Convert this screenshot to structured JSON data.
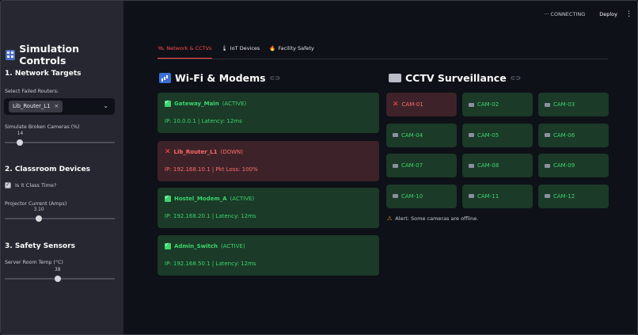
{
  "topbar": {
    "status_label": "CONNECTING",
    "deploy_label": "Deploy"
  },
  "sidebar": {
    "title": "Simulation Controls",
    "section1": "1. Network Targets",
    "failed_routers_label": "Select Failed Routers:",
    "failed_routers_selected": [
      "Lib_Router_L1"
    ],
    "broken_cameras_label": "Simulate Broken Cameras (%)",
    "broken_cameras_value": 14,
    "broken_cameras_fraction": 0.14,
    "section2": "2. Classroom Devices",
    "class_time_label": "Is it Class Time?",
    "class_time_checked": true,
    "projector_label": "Projector Current (Amps)",
    "projector_value": "3.10",
    "projector_fraction": 0.31,
    "section3": "3. Safety Sensors",
    "temp_label": "Server Room Temp (°C)",
    "temp_value": 38,
    "temp_fraction": 0.48
  },
  "tabs": [
    {
      "label": "Network & CCTVs",
      "icon": "satellite-icon",
      "active": true
    },
    {
      "label": "IoT Devices",
      "icon": "thermometer-icon",
      "active": false
    },
    {
      "label": "Facility Safety",
      "icon": "fire-icon",
      "active": false
    }
  ],
  "wifi": {
    "title": "Wi-Fi & Modems",
    "routers": [
      {
        "name": "Gateway_Main",
        "status": "(ACTIVE)",
        "detail": "IP: 10.0.0.1 | Latency: 12ms",
        "ok": true
      },
      {
        "name": "Lib_Router_L1",
        "status": "(DOWN)",
        "detail": "IP: 192.168.10.1 | Pkt Loss: 100%",
        "ok": false
      },
      {
        "name": "Hostel_Modem_A",
        "status": "(ACTIVE)",
        "detail": "IP: 192.168.20.1 | Latency: 12ms",
        "ok": true
      },
      {
        "name": "Admin_Switch",
        "status": "(ACTIVE)",
        "detail": "IP: 192.168.50.1 | Latency: 12ms",
        "ok": true
      }
    ]
  },
  "cctv": {
    "title": "CCTV Surveillance",
    "cameras": [
      {
        "label": "CAM-01",
        "online": false
      },
      {
        "label": "CAM-02",
        "online": true
      },
      {
        "label": "CAM-03",
        "online": true
      },
      {
        "label": "CAM-04",
        "online": true
      },
      {
        "label": "CAM-05",
        "online": true
      },
      {
        "label": "CAM-06",
        "online": true
      },
      {
        "label": "CAM-07",
        "online": true
      },
      {
        "label": "CAM-08",
        "online": true
      },
      {
        "label": "CAM-09",
        "online": true
      },
      {
        "label": "CAM-10",
        "online": true
      },
      {
        "label": "CAM-11",
        "online": true
      },
      {
        "label": "CAM-12",
        "online": true
      }
    ],
    "alert": "Alert: Some cameras are offline."
  }
}
